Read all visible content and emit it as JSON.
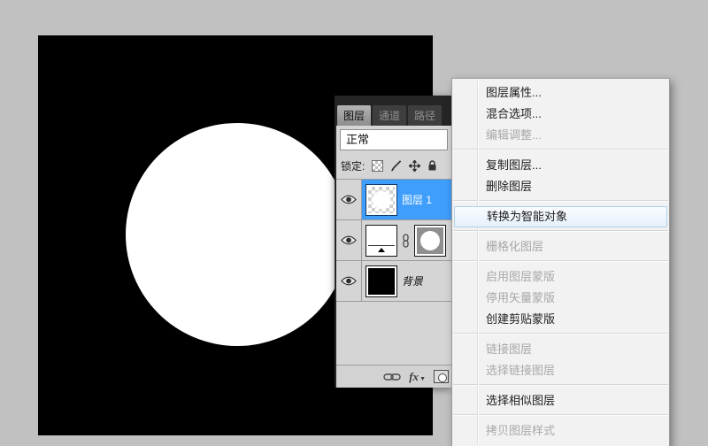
{
  "app": "photoshop",
  "canvas": {
    "background_color": "#000000",
    "circle_color": "#ffffff"
  },
  "layers_panel": {
    "tabs": [
      {
        "label": "图层",
        "active": true
      },
      {
        "label": "通道",
        "active": false
      },
      {
        "label": "路径",
        "active": false
      }
    ],
    "blend_mode": "正常",
    "lock_label": "锁定:",
    "lock_icons": [
      "transparency-lock-icon",
      "brush-lock-icon",
      "move-lock-icon",
      "lock-all-icon"
    ],
    "layers": [
      {
        "name": "图层 1",
        "selected": true,
        "visible": true,
        "thumb": "checkerboard-with-white-circle"
      },
      {
        "name": "",
        "selected": false,
        "visible": true,
        "thumb": "levels-adjustment",
        "mask": "white-circle-on-gray",
        "linked": true
      },
      {
        "name": "背景",
        "selected": false,
        "visible": true,
        "thumb": "black",
        "italic": true
      }
    ],
    "bottom_bar": {
      "fx_label": "fx",
      "icons": [
        "link-layers-icon",
        "layer-style-fx-icon",
        "add-layer-mask-icon"
      ]
    },
    "colors": {
      "selection_blue": "#3f9efb",
      "panel_gray": "#d5d5d5",
      "header_dark": "#252525"
    }
  },
  "context_menu": {
    "items": [
      {
        "label": "图层属性...",
        "state": "enabled"
      },
      {
        "label": "混合选项...",
        "state": "enabled"
      },
      {
        "label": "编辑调整...",
        "state": "disabled"
      },
      {
        "type": "separator"
      },
      {
        "label": "复制图层...",
        "state": "enabled"
      },
      {
        "label": "删除图层",
        "state": "enabled"
      },
      {
        "type": "separator"
      },
      {
        "label": "转换为智能对象",
        "state": "highlighted"
      },
      {
        "type": "separator"
      },
      {
        "label": "栅格化图层",
        "state": "disabled"
      },
      {
        "type": "separator"
      },
      {
        "label": "启用图层蒙版",
        "state": "disabled"
      },
      {
        "label": "停用矢量蒙版",
        "state": "disabled"
      },
      {
        "label": "创建剪贴蒙版",
        "state": "enabled"
      },
      {
        "type": "separator"
      },
      {
        "label": "链接图层",
        "state": "disabled"
      },
      {
        "label": "选择链接图层",
        "state": "disabled"
      },
      {
        "type": "separator"
      },
      {
        "label": "选择相似图层",
        "state": "enabled"
      },
      {
        "type": "separator"
      },
      {
        "label": "拷贝图层样式",
        "state": "disabled"
      }
    ],
    "colors": {
      "background": "#f2f2f2",
      "highlight_border": "#aed2ec",
      "disabled_text": "#a8a8a8"
    }
  }
}
